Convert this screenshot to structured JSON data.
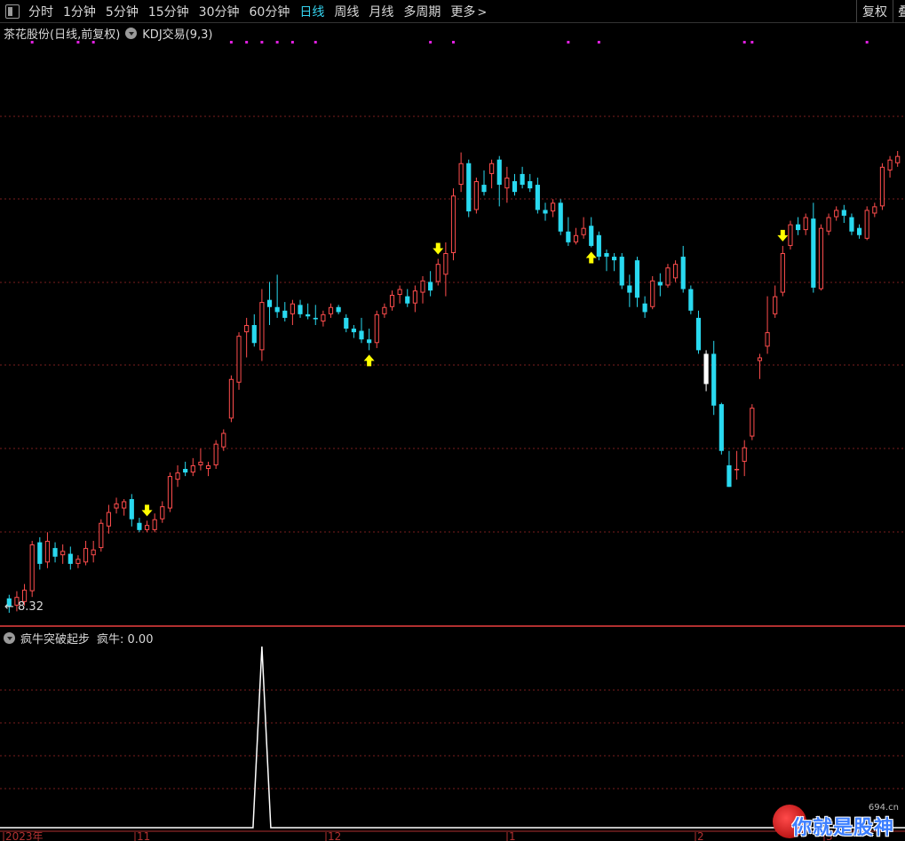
{
  "toolbar": {
    "periods": [
      "分时",
      "1分钟",
      "5分钟",
      "15分钟",
      "30分钟",
      "60分钟",
      "日线",
      "周线",
      "月线",
      "多周期"
    ],
    "active": "日线",
    "more_label": "更多",
    "fuquan_label": "复权",
    "cut_label": "叠"
  },
  "main_header": {
    "stock_title": "茶花股份(日线,前复权)",
    "indicator": "KDJ交易(9,3)"
  },
  "sub_header": {
    "indicator_name": "疯牛突破起步",
    "value_label": "疯牛: 0.00"
  },
  "x_axis_labels": [
    "2023年",
    "11",
    "12",
    "1",
    "2",
    "3"
  ],
  "low_marker": "8.32",
  "colors": {
    "up": "#ff4d4d",
    "down": "#29d9f0",
    "neutral": "#ffffff",
    "signal": "#ffff00",
    "dot": "#e020e0",
    "grid": "#7a1e1e",
    "accent": "#35d4f0"
  },
  "watermark": {
    "text": "你就是股神",
    "site": "694.cn"
  },
  "chart_data": [
    {
      "type": "candlestick",
      "candles": [
        {
          "o": 8.5,
          "h": 8.55,
          "l": 8.3,
          "c": 8.38
        },
        {
          "o": 8.4,
          "h": 8.6,
          "l": 8.32,
          "c": 8.52
        },
        {
          "o": 8.45,
          "h": 8.7,
          "l": 8.4,
          "c": 8.62
        },
        {
          "o": 8.6,
          "h": 9.3,
          "l": 8.52,
          "c": 9.25
        },
        {
          "o": 9.28,
          "h": 9.35,
          "l": 8.9,
          "c": 8.98
        },
        {
          "o": 9.0,
          "h": 9.42,
          "l": 8.92,
          "c": 9.3
        },
        {
          "o": 9.2,
          "h": 9.28,
          "l": 9.0,
          "c": 9.08
        },
        {
          "o": 9.1,
          "h": 9.25,
          "l": 8.98,
          "c": 9.16
        },
        {
          "o": 9.12,
          "h": 9.22,
          "l": 8.9,
          "c": 8.98
        },
        {
          "o": 8.98,
          "h": 9.1,
          "l": 8.92,
          "c": 9.05
        },
        {
          "o": 9.0,
          "h": 9.3,
          "l": 8.96,
          "c": 9.2
        },
        {
          "o": 9.1,
          "h": 9.3,
          "l": 9.0,
          "c": 9.18
        },
        {
          "o": 9.2,
          "h": 9.6,
          "l": 9.15,
          "c": 9.55
        },
        {
          "o": 9.5,
          "h": 9.8,
          "l": 9.4,
          "c": 9.7
        },
        {
          "o": 9.75,
          "h": 9.9,
          "l": 9.68,
          "c": 9.82
        },
        {
          "o": 9.75,
          "h": 9.88,
          "l": 9.65,
          "c": 9.85
        },
        {
          "o": 9.88,
          "h": 9.95,
          "l": 9.5,
          "c": 9.6
        },
        {
          "o": 9.55,
          "h": 9.62,
          "l": 9.42,
          "c": 9.45
        },
        {
          "o": 9.45,
          "h": 9.58,
          "l": 9.42,
          "c": 9.52
        },
        {
          "o": 9.45,
          "h": 9.68,
          "l": 9.42,
          "c": 9.6
        },
        {
          "o": 9.6,
          "h": 9.85,
          "l": 9.55,
          "c": 9.78
        },
        {
          "o": 9.75,
          "h": 10.25,
          "l": 9.7,
          "c": 10.2
        },
        {
          "o": 10.15,
          "h": 10.35,
          "l": 10.05,
          "c": 10.25
        },
        {
          "o": 10.3,
          "h": 10.4,
          "l": 10.2,
          "c": 10.25
        },
        {
          "o": 10.25,
          "h": 10.45,
          "l": 10.2,
          "c": 10.35
        },
        {
          "o": 10.35,
          "h": 10.58,
          "l": 10.28,
          "c": 10.4
        },
        {
          "o": 10.3,
          "h": 10.4,
          "l": 10.2,
          "c": 10.35
        },
        {
          "o": 10.35,
          "h": 10.7,
          "l": 10.3,
          "c": 10.65
        },
        {
          "o": 10.6,
          "h": 10.85,
          "l": 10.55,
          "c": 10.8
        },
        {
          "o": 11.0,
          "h": 11.6,
          "l": 10.95,
          "c": 11.55
        },
        {
          "o": 11.5,
          "h": 12.2,
          "l": 11.4,
          "c": 12.15
        },
        {
          "o": 12.2,
          "h": 12.4,
          "l": 11.85,
          "c": 12.3
        },
        {
          "o": 12.3,
          "h": 12.45,
          "l": 12.0,
          "c": 12.05
        },
        {
          "o": 11.95,
          "h": 12.8,
          "l": 11.8,
          "c": 12.62
        },
        {
          "o": 12.65,
          "h": 12.9,
          "l": 12.3,
          "c": 12.55
        },
        {
          "o": 12.55,
          "h": 13.0,
          "l": 12.4,
          "c": 12.48
        },
        {
          "o": 12.5,
          "h": 12.62,
          "l": 12.35,
          "c": 12.4
        },
        {
          "o": 12.45,
          "h": 12.65,
          "l": 12.3,
          "c": 12.6
        },
        {
          "o": 12.58,
          "h": 12.65,
          "l": 12.4,
          "c": 12.45
        },
        {
          "o": 12.45,
          "h": 12.6,
          "l": 12.38,
          "c": 12.42
        },
        {
          "o": 12.4,
          "h": 12.58,
          "l": 12.3,
          "c": 12.38
        },
        {
          "o": 12.35,
          "h": 12.5,
          "l": 12.28,
          "c": 12.45
        },
        {
          "o": 12.45,
          "h": 12.6,
          "l": 12.4,
          "c": 12.55
        },
        {
          "o": 12.55,
          "h": 12.58,
          "l": 12.45,
          "c": 12.48
        },
        {
          "o": 12.4,
          "h": 12.45,
          "l": 12.2,
          "c": 12.25
        },
        {
          "o": 12.25,
          "h": 12.3,
          "l": 12.12,
          "c": 12.2
        },
        {
          "o": 12.22,
          "h": 12.4,
          "l": 12.05,
          "c": 12.1
        },
        {
          "o": 12.1,
          "h": 12.25,
          "l": 11.95,
          "c": 12.05
        },
        {
          "o": 12.05,
          "h": 12.5,
          "l": 11.98,
          "c": 12.45
        },
        {
          "o": 12.45,
          "h": 12.6,
          "l": 12.4,
          "c": 12.55
        },
        {
          "o": 12.55,
          "h": 12.78,
          "l": 12.5,
          "c": 12.72
        },
        {
          "o": 12.72,
          "h": 12.85,
          "l": 12.6,
          "c": 12.8
        },
        {
          "o": 12.7,
          "h": 12.8,
          "l": 12.55,
          "c": 12.6
        },
        {
          "o": 12.6,
          "h": 12.85,
          "l": 12.48,
          "c": 12.78
        },
        {
          "o": 12.75,
          "h": 12.98,
          "l": 12.6,
          "c": 12.92
        },
        {
          "o": 12.9,
          "h": 13.05,
          "l": 12.7,
          "c": 12.78
        },
        {
          "o": 12.9,
          "h": 13.22,
          "l": 12.85,
          "c": 13.15
        },
        {
          "o": 13.0,
          "h": 13.45,
          "l": 12.7,
          "c": 13.3
        },
        {
          "o": 13.3,
          "h": 14.2,
          "l": 13.2,
          "c": 14.1
        },
        {
          "o": 14.25,
          "h": 14.7,
          "l": 14.15,
          "c": 14.55
        },
        {
          "o": 14.55,
          "h": 14.6,
          "l": 13.8,
          "c": 13.88
        },
        {
          "o": 13.9,
          "h": 14.35,
          "l": 13.85,
          "c": 14.3
        },
        {
          "o": 14.25,
          "h": 14.45,
          "l": 14.1,
          "c": 14.15
        },
        {
          "o": 14.4,
          "h": 14.6,
          "l": 14.2,
          "c": 14.55
        },
        {
          "o": 14.6,
          "h": 14.65,
          "l": 13.95,
          "c": 14.25
        },
        {
          "o": 14.2,
          "h": 14.5,
          "l": 14.0,
          "c": 14.35
        },
        {
          "o": 14.3,
          "h": 14.4,
          "l": 14.1,
          "c": 14.15
        },
        {
          "o": 14.4,
          "h": 14.5,
          "l": 14.2,
          "c": 14.25
        },
        {
          "o": 14.3,
          "h": 14.4,
          "l": 14.15,
          "c": 14.2
        },
        {
          "o": 14.25,
          "h": 14.35,
          "l": 13.85,
          "c": 13.9
        },
        {
          "o": 13.9,
          "h": 14.0,
          "l": 13.75,
          "c": 13.85
        },
        {
          "o": 13.88,
          "h": 14.05,
          "l": 13.8,
          "c": 14.0
        },
        {
          "o": 14.0,
          "h": 14.05,
          "l": 13.55,
          "c": 13.6
        },
        {
          "o": 13.6,
          "h": 13.8,
          "l": 13.4,
          "c": 13.45
        },
        {
          "o": 13.45,
          "h": 13.65,
          "l": 13.42,
          "c": 13.55
        },
        {
          "o": 13.55,
          "h": 13.8,
          "l": 13.5,
          "c": 13.65
        },
        {
          "o": 13.68,
          "h": 13.8,
          "l": 13.38,
          "c": 13.4
        },
        {
          "o": 13.55,
          "h": 13.6,
          "l": 13.2,
          "c": 13.25
        },
        {
          "o": 13.3,
          "h": 13.35,
          "l": 13.05,
          "c": 13.25
        },
        {
          "o": 13.25,
          "h": 13.3,
          "l": 13.05,
          "c": 13.2
        },
        {
          "o": 13.25,
          "h": 13.3,
          "l": 12.8,
          "c": 12.85
        },
        {
          "o": 12.85,
          "h": 13.0,
          "l": 12.55,
          "c": 12.75
        },
        {
          "o": 13.2,
          "h": 13.25,
          "l": 12.55,
          "c": 12.68
        },
        {
          "o": 12.6,
          "h": 12.7,
          "l": 12.4,
          "c": 12.48
        },
        {
          "o": 12.55,
          "h": 12.98,
          "l": 12.52,
          "c": 12.92
        },
        {
          "o": 12.9,
          "h": 13.02,
          "l": 12.7,
          "c": 12.85
        },
        {
          "o": 12.85,
          "h": 13.15,
          "l": 12.82,
          "c": 13.1
        },
        {
          "o": 12.95,
          "h": 13.2,
          "l": 12.9,
          "c": 13.15
        },
        {
          "o": 13.25,
          "h": 13.4,
          "l": 12.75,
          "c": 12.8
        },
        {
          "o": 12.8,
          "h": 12.85,
          "l": 12.45,
          "c": 12.5
        },
        {
          "o": 12.4,
          "h": 12.5,
          "l": 11.9,
          "c": 11.95
        },
        {
          "o": 11.9,
          "h": 11.95,
          "l": 11.38,
          "c": 11.48
        },
        {
          "o": 11.9,
          "h": 12.08,
          "l": 11.05,
          "c": 11.18
        },
        {
          "o": 11.2,
          "h": 11.22,
          "l": 10.5,
          "c": 10.55
        },
        {
          "o": 10.35,
          "h": 10.55,
          "l": 10.05,
          "c": 10.05
        },
        {
          "o": 10.3,
          "h": 10.55,
          "l": 10.15,
          "c": 10.3
        },
        {
          "o": 10.4,
          "h": 10.7,
          "l": 10.2,
          "c": 10.6
        },
        {
          "o": 10.75,
          "h": 11.2,
          "l": 10.7,
          "c": 11.15
        },
        {
          "o": 11.8,
          "h": 11.9,
          "l": 11.55,
          "c": 11.85
        },
        {
          "o": 12.0,
          "h": 12.7,
          "l": 11.9,
          "c": 12.2
        },
        {
          "o": 12.45,
          "h": 12.85,
          "l": 12.4,
          "c": 12.7
        },
        {
          "o": 12.75,
          "h": 13.4,
          "l": 12.7,
          "c": 13.3
        },
        {
          "o": 13.4,
          "h": 13.75,
          "l": 13.35,
          "c": 13.7
        },
        {
          "o": 13.7,
          "h": 13.8,
          "l": 13.55,
          "c": 13.62
        },
        {
          "o": 13.62,
          "h": 13.85,
          "l": 13.55,
          "c": 13.8
        },
        {
          "o": 13.78,
          "h": 14.0,
          "l": 12.75,
          "c": 12.82
        },
        {
          "o": 12.8,
          "h": 13.7,
          "l": 12.78,
          "c": 13.65
        },
        {
          "o": 13.6,
          "h": 13.85,
          "l": 13.55,
          "c": 13.8
        },
        {
          "o": 13.8,
          "h": 13.95,
          "l": 13.75,
          "c": 13.9
        },
        {
          "o": 13.9,
          "h": 13.97,
          "l": 13.72,
          "c": 13.82
        },
        {
          "o": 13.8,
          "h": 13.85,
          "l": 13.55,
          "c": 13.6
        },
        {
          "o": 13.65,
          "h": 13.7,
          "l": 13.5,
          "c": 13.55
        },
        {
          "o": 13.5,
          "h": 13.95,
          "l": 13.48,
          "c": 13.9
        },
        {
          "o": 13.85,
          "h": 14.0,
          "l": 13.8,
          "c": 13.95
        },
        {
          "o": 13.95,
          "h": 14.55,
          "l": 13.9,
          "c": 14.5
        },
        {
          "o": 14.45,
          "h": 14.65,
          "l": 14.35,
          "c": 14.6
        },
        {
          "o": 14.55,
          "h": 14.72,
          "l": 14.5,
          "c": 14.65
        }
      ],
      "special_neutral_index": 91,
      "sell_arrows": [
        18,
        56,
        101
      ],
      "buy_arrows": [
        47,
        76
      ],
      "signal_dots": [
        3,
        9,
        11,
        29,
        31,
        33,
        35,
        37,
        40,
        55,
        58,
        73,
        77,
        96,
        97,
        112
      ],
      "xlabel": "",
      "ylabel": ""
    },
    {
      "type": "line",
      "name": "疯牛",
      "spike_index": 33,
      "spike_value": 1,
      "ylim": [
        0,
        1
      ]
    }
  ]
}
